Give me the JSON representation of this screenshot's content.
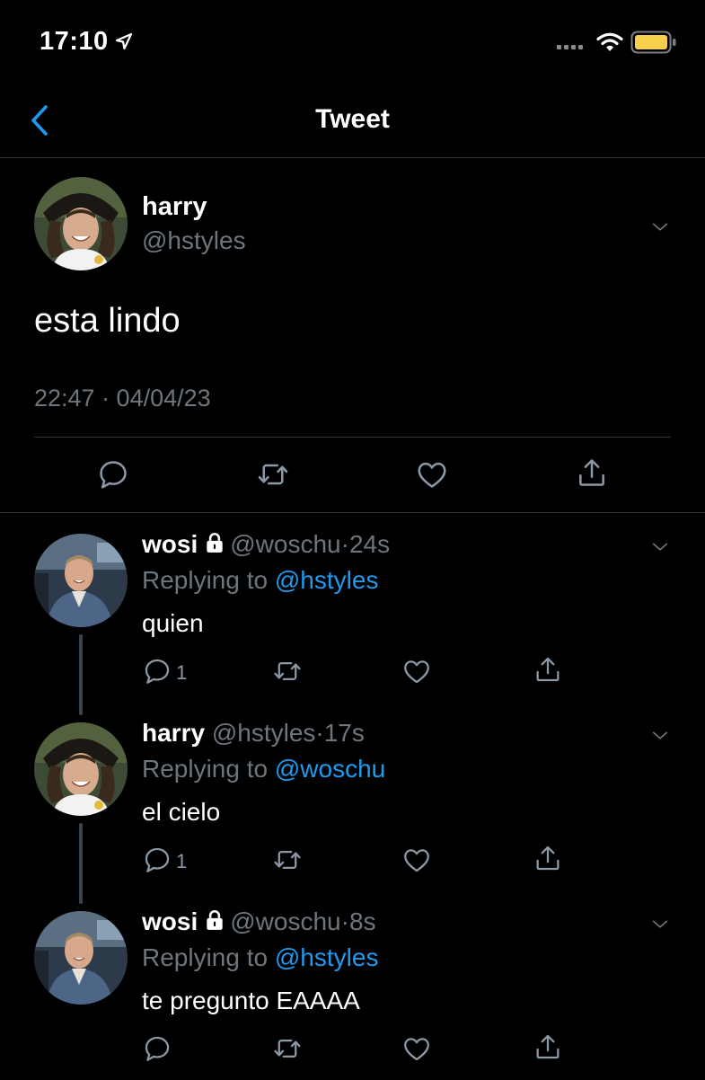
{
  "status_bar": {
    "time": "17:10"
  },
  "nav": {
    "title": "Tweet"
  },
  "main_tweet": {
    "name": "harry",
    "handle": "@hstyles",
    "text": "esta lindo",
    "timestamp": "22:47 · 04/04/23"
  },
  "replies": [
    {
      "name": "wosi",
      "handle": "@woschu",
      "dot": "·",
      "time": "24s",
      "replying_prefix": "Replying to ",
      "replying_to": "@hstyles",
      "text": "quien",
      "reply_count": "1"
    },
    {
      "name": "harry",
      "handle": "@hstyles",
      "dot": "·",
      "time": "17s",
      "replying_prefix": "Replying to ",
      "replying_to": "@woschu",
      "text": "el cielo",
      "reply_count": "1"
    },
    {
      "name": "wosi",
      "handle": "@woschu",
      "dot": "·",
      "time": "8s",
      "replying_prefix": "Replying to ",
      "replying_to": "@hstyles",
      "text": "te pregunto EAAAA",
      "reply_count": ""
    }
  ],
  "colors": {
    "background": "#000000",
    "link": "#1d9bf0",
    "secondary_text": "#6e767d",
    "divider": "#2f3336",
    "battery": "#f7d14c"
  },
  "icons": [
    "location-arrow-icon",
    "wifi-icon",
    "battery-icon",
    "back-chevron-icon",
    "chevron-down-icon",
    "lock-icon",
    "reply-icon",
    "retweet-icon",
    "like-icon",
    "share-icon"
  ]
}
